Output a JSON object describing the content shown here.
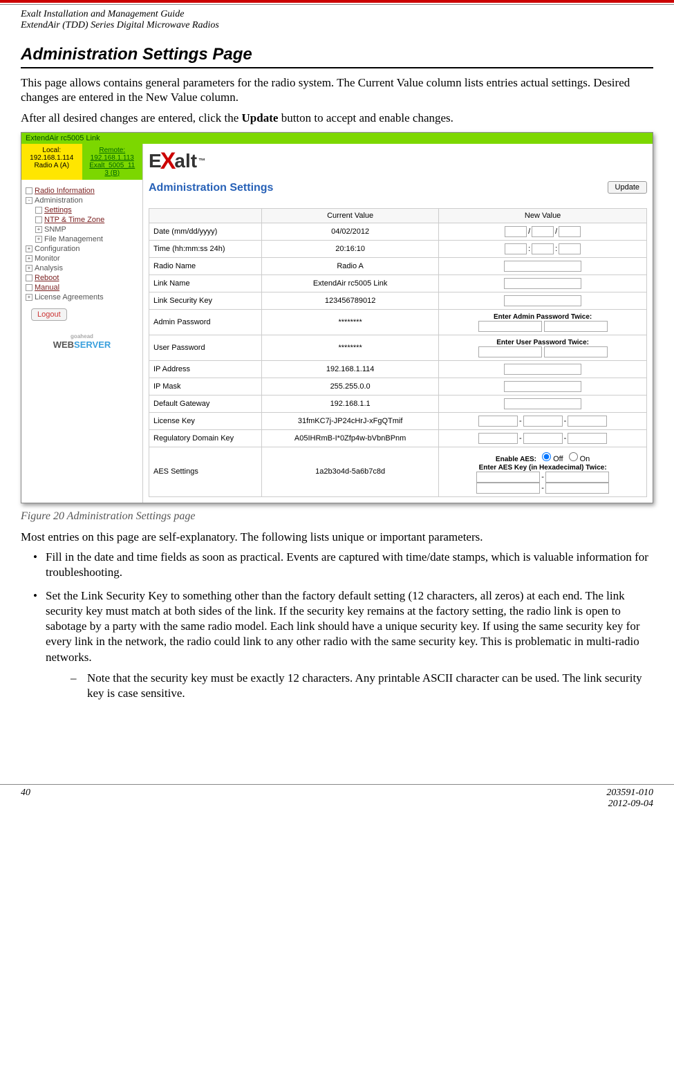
{
  "header": {
    "line1": "Exalt Installation and Management Guide",
    "line2": "ExtendAir (TDD) Series Digital Microwave Radios"
  },
  "title": "Administration Settings Page",
  "para1": "This page allows contains general parameters for the radio system. The Current Value column lists entries actual settings. Desired changes are entered in the New Value column.",
  "para2_a": "After all desired changes are entered, click the ",
  "para2_bold": "Update",
  "para2_b": " button to accept and enable changes.",
  "screenshot": {
    "topbar": "ExtendAir rc5005 Link",
    "local": {
      "l1": "Local:",
      "l2": "192.168.1.114",
      "l3": "Radio A (A)"
    },
    "remote": {
      "l1": "Remote:",
      "l2": "192.168.1.113",
      "l3": "Exalt_5005_11",
      "l4": "3 (B)"
    },
    "nav": {
      "radio_info": "Radio Information",
      "administration": "Administration",
      "settings": "Settings",
      "ntp": "NTP & Time Zone",
      "snmp": "SNMP",
      "filemgmt": "File Management",
      "configuration": "Configuration",
      "monitor": "Monitor",
      "analysis": "Analysis",
      "reboot": "Reboot",
      "manual": "Manual",
      "license": "License Agreements",
      "logout": "Logout",
      "web": "WEB",
      "server": "SERVER",
      "goahead": "goahead"
    },
    "logo": {
      "e": "E",
      "x": "X",
      "alt": "alt",
      "tm": "™"
    },
    "admin_title": "Administration Settings",
    "update": "Update",
    "cols": {
      "current": "Current Value",
      "newv": "New Value"
    },
    "rows": {
      "date": {
        "label": "Date (mm/dd/yyyy)",
        "val": "04/02/2012"
      },
      "time": {
        "label": "Time (hh:mm:ss 24h)",
        "val": "20:16:10"
      },
      "radioname": {
        "label": "Radio Name",
        "val": "Radio A"
      },
      "linkname": {
        "label": "Link Name",
        "val": "ExtendAir rc5005 Link"
      },
      "lsk": {
        "label": "Link Security Key",
        "val": "123456789012"
      },
      "adminpw": {
        "label": "Admin Password",
        "val": "********",
        "hint": "Enter Admin Password Twice:"
      },
      "userpw": {
        "label": "User Password",
        "val": "********",
        "hint": "Enter User Password Twice:"
      },
      "ip": {
        "label": "IP Address",
        "val": "192.168.1.114"
      },
      "mask": {
        "label": "IP Mask",
        "val": "255.255.0.0"
      },
      "gw": {
        "label": "Default Gateway",
        "val": "192.168.1.1"
      },
      "lic": {
        "label": "License Key",
        "val": "31fmKC7j-JP24cHrJ-xFgQTmif"
      },
      "reg": {
        "label": "Regulatory Domain Key",
        "val": "A05IHRmB-I*0Zfp4w-bVbnBPnm"
      },
      "aes": {
        "label": "AES Settings",
        "val": "1a2b3o4d-5a6b7c8d",
        "hint1": "Enable AES:",
        "off": "Off",
        "on": "On",
        "hint2": "Enter AES Key (in Hexadecimal) Twice:"
      }
    }
  },
  "figcap": "Figure 20   Administration Settings page",
  "para3": "Most entries on this page are self-explanatory. The following lists unique or important parameters.",
  "b1": "Fill in the date and time fields as soon as practical. Events are captured with time/date stamps, which is valuable information for troubleshooting.",
  "b2": "Set the Link Security Key to something other than the factory default setting (12 characters, all zeros) at each end. The link security key must match at both sides of the link. If the security key remains at the factory setting, the radio link is open to sabotage by a party with the same radio model. Each link should have a unique security key. If using the same security key for every link in the network, the radio could link to any other radio with the same security key. This is problematic in multi-radio networks.",
  "b2s1": "Note that the security key must be exactly 12 characters. Any printable ASCII character can be used. The link security key is case sensitive.",
  "footer": {
    "page": "40",
    "doc": "203591-010",
    "date": "2012-09-04"
  }
}
